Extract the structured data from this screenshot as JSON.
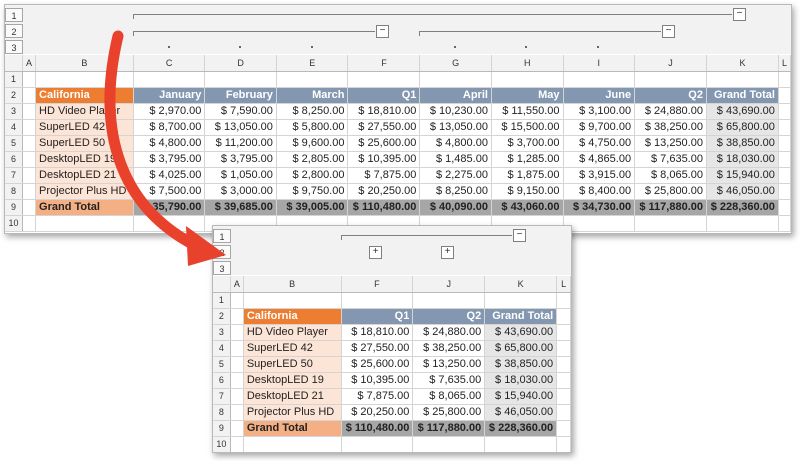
{
  "outline_levels": [
    "1",
    "2",
    "3"
  ],
  "outline_toggles": {
    "collapse": "−",
    "expand": "+"
  },
  "top": {
    "col_headers": [
      "A",
      "B",
      "C",
      "D",
      "E",
      "F",
      "G",
      "H",
      "I",
      "J",
      "K",
      "L"
    ],
    "rows": [
      "1",
      "2",
      "3",
      "4",
      "5",
      "6",
      "7",
      "8",
      "9",
      "10"
    ],
    "header": [
      "California",
      "January",
      "February",
      "March",
      "Q1",
      "April",
      "May",
      "June",
      "Q2",
      "Grand Total"
    ],
    "products": [
      "HD Video Player",
      "SuperLED 42",
      "SuperLED 50",
      "DesktopLED 19",
      "DesktopLED 21",
      "Projector Plus HD"
    ],
    "values": [
      [
        "$ 2,970.00",
        "$ 7,590.00",
        "$ 8,250.00",
        "$ 18,810.00",
        "$ 10,230.00",
        "$ 11,550.00",
        "$ 3,100.00",
        "$ 24,880.00",
        "$ 43,690.00"
      ],
      [
        "$ 8,700.00",
        "$ 13,050.00",
        "$ 5,800.00",
        "$ 27,550.00",
        "$ 13,050.00",
        "$ 15,500.00",
        "$ 9,700.00",
        "$ 38,250.00",
        "$ 65,800.00"
      ],
      [
        "$ 4,800.00",
        "$ 11,200.00",
        "$ 9,600.00",
        "$ 25,600.00",
        "$ 4,800.00",
        "$ 3,700.00",
        "$ 4,750.00",
        "$ 13,250.00",
        "$ 38,850.00"
      ],
      [
        "$ 3,795.00",
        "$ 3,795.00",
        "$ 2,805.00",
        "$ 10,395.00",
        "$ 1,485.00",
        "$ 1,285.00",
        "$ 4,865.00",
        "$ 7,635.00",
        "$ 18,030.00"
      ],
      [
        "$ 4,025.00",
        "$ 1,050.00",
        "$ 2,800.00",
        "$ 7,875.00",
        "$ 2,275.00",
        "$ 1,875.00",
        "$ 3,915.00",
        "$ 8,065.00",
        "$ 15,940.00"
      ],
      [
        "$ 7,500.00",
        "$ 3,000.00",
        "$ 9,750.00",
        "$ 20,250.00",
        "$ 8,250.00",
        "$ 9,150.00",
        "$ 8,400.00",
        "$ 25,800.00",
        "$ 46,050.00"
      ]
    ],
    "grand_total_label": "Grand Total",
    "grand_total": [
      "$ 35,790.00",
      "$ 39,685.00",
      "$ 39,005.00",
      "$ 110,480.00",
      "$ 40,090.00",
      "$ 43,060.00",
      "$ 34,730.00",
      "$ 117,880.00",
      "$ 228,360.00"
    ]
  },
  "bottom": {
    "col_headers": [
      "A",
      "B",
      "F",
      "J",
      "K",
      "L"
    ],
    "rows": [
      "1",
      "2",
      "3",
      "4",
      "5",
      "6",
      "7",
      "8",
      "9",
      "10"
    ],
    "header": [
      "California",
      "Q1",
      "Q2",
      "Grand Total"
    ],
    "products": [
      "HD Video Player",
      "SuperLED 42",
      "SuperLED 50",
      "DesktopLED 19",
      "DesktopLED 21",
      "Projector Plus HD"
    ],
    "values": [
      [
        "$ 18,810.00",
        "$ 24,880.00",
        "$ 43,690.00"
      ],
      [
        "$ 27,550.00",
        "$ 38,250.00",
        "$ 65,800.00"
      ],
      [
        "$ 25,600.00",
        "$ 13,250.00",
        "$ 38,850.00"
      ],
      [
        "$ 10,395.00",
        "$ 7,635.00",
        "$ 18,030.00"
      ],
      [
        "$ 7,875.00",
        "$ 8,065.00",
        "$ 15,940.00"
      ],
      [
        "$ 20,250.00",
        "$ 25,800.00",
        "$ 46,050.00"
      ]
    ],
    "grand_total_label": "Grand Total",
    "grand_total": [
      "$ 110,480.00",
      "$ 117,880.00",
      "$ 228,360.00"
    ]
  },
  "colors": {
    "accent_orange": "#ed7d31",
    "header_blue": "#8497b0",
    "arrow_red": "#e8412c"
  }
}
